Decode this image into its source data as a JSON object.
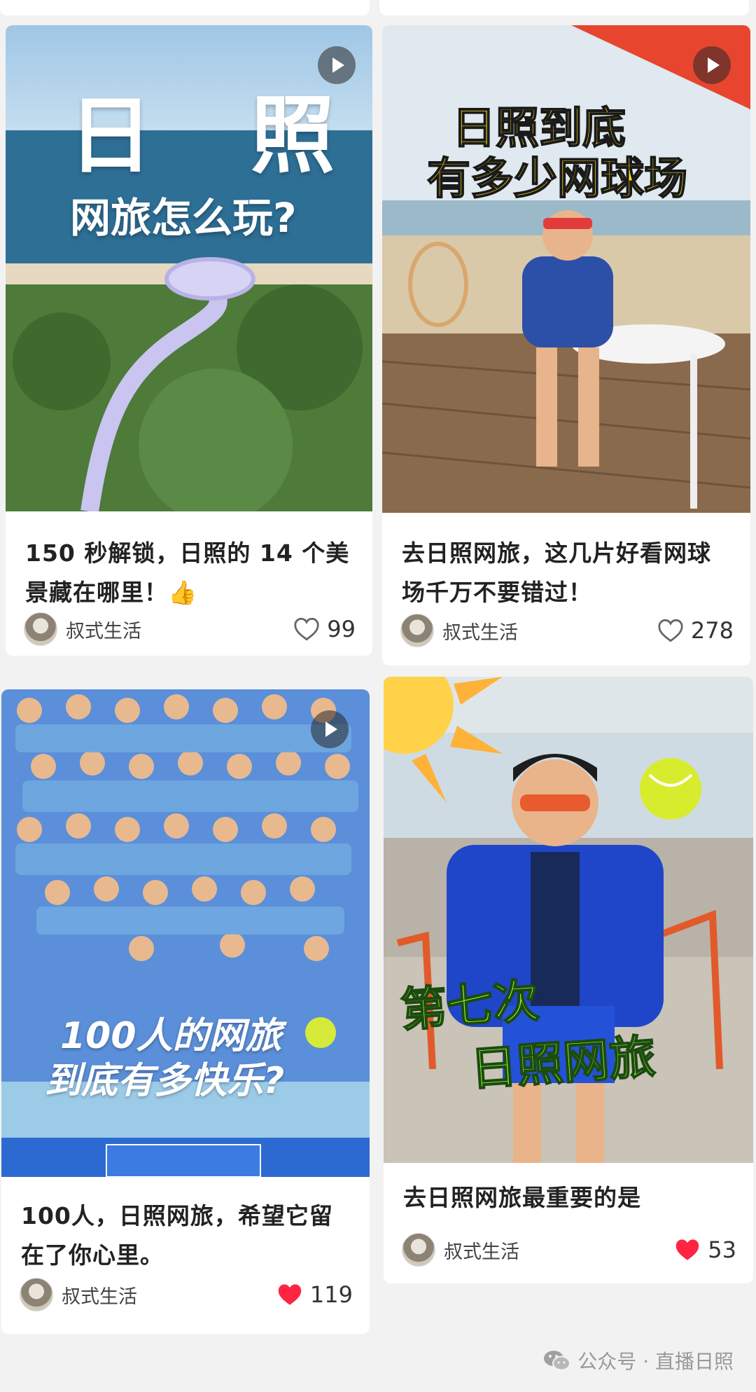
{
  "cards": [
    {
      "thumb_text_line1": "日　照",
      "thumb_text_line2": "网旅怎么玩?",
      "title": "150 秒解锁，日照的 14 个美景藏在哪里！👍",
      "author": "叔式生活",
      "likes": "99",
      "liked": false,
      "has_video": true
    },
    {
      "thumb_text_line1": "日照到底",
      "thumb_text_line2": "有多少网球场",
      "title": "去日照网旅，这几片好看网球场千万不要错过！",
      "author": "叔式生活",
      "likes": "278",
      "liked": false,
      "has_video": true
    },
    {
      "thumb_text_line1": "100人的网旅",
      "thumb_text_line2": "到底有多快乐?",
      "title": "100人，日照网旅，希望它留在了你心里。",
      "author": "叔式生活",
      "likes": "119",
      "liked": true,
      "has_video": true
    },
    {
      "thumb_text_line1": "第七次",
      "thumb_text_line2": "日照网旅",
      "title": "去日照网旅最重要的是",
      "author": "叔式生活",
      "likes": "53",
      "liked": true,
      "has_video": false
    }
  ],
  "watermark": {
    "text": "公众号 · 直播日照",
    "icon": "wechat-icon"
  },
  "colors": {
    "like_active": "#ff2442",
    "like_inactive": "#666666",
    "background": "#f2f2f2"
  }
}
